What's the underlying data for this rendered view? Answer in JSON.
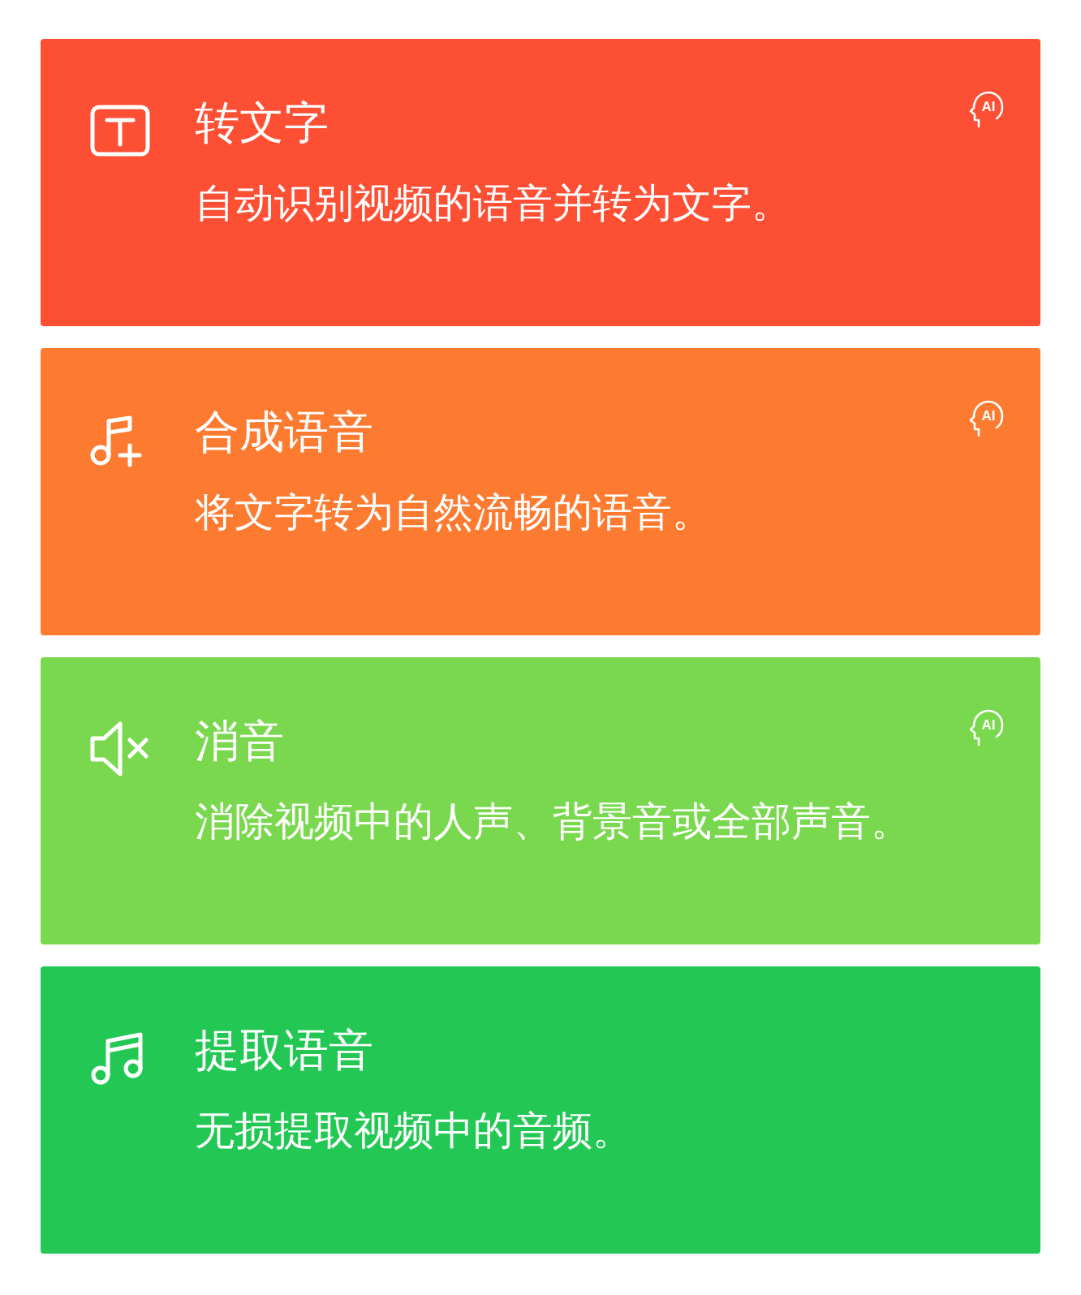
{
  "cards": [
    {
      "kind": "text-box",
      "color": "#fc4f33",
      "title": "转文字",
      "description": "自动识别视频的语音并转为文字。",
      "badge": "AI"
    },
    {
      "kind": "music-plus",
      "color": "#fc7b30",
      "title": "合成语音",
      "description": "将文字转为自然流畅的语音。",
      "badge": "AI"
    },
    {
      "kind": "mute",
      "color": "#7ad84e",
      "title": "消音",
      "description": "消除视频中的人声、背景音或全部声音。",
      "badge": "AI"
    },
    {
      "kind": "music",
      "color": "#22c853",
      "title": "提取语音",
      "description": "无损提取视频中的音频。"
    }
  ]
}
